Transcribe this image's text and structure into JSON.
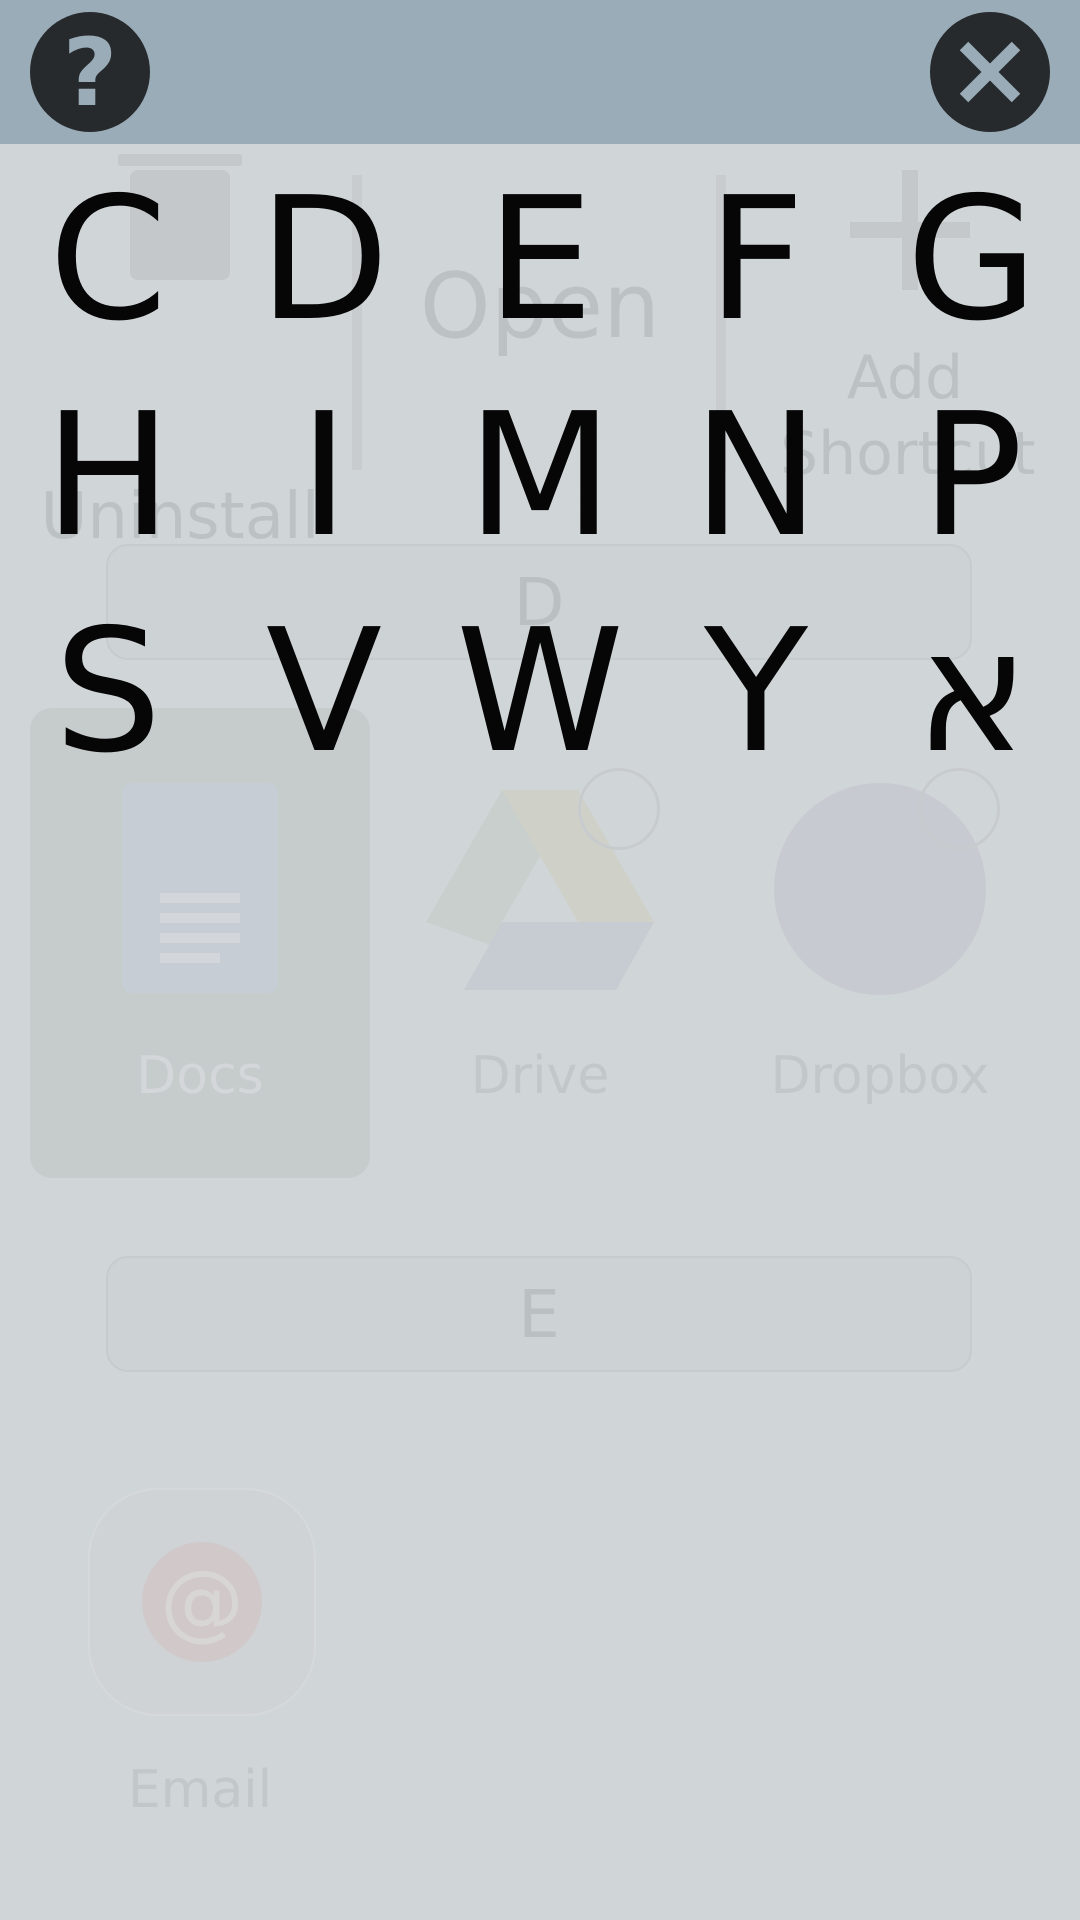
{
  "header": {
    "help_icon": "help-icon",
    "help_glyph": "?",
    "close_icon": "close-icon"
  },
  "letters": [
    "C",
    "D",
    "E",
    "F",
    "G",
    "H",
    "I",
    "M",
    "N",
    "P",
    "S",
    "V",
    "W",
    "Y",
    "א"
  ],
  "background": {
    "actions": {
      "uninstall": "Uninstall",
      "open": "Open",
      "add_shortcut": "Add Shortcut"
    },
    "sections": {
      "d": "D",
      "e": "E"
    },
    "apps": {
      "docs": "Docs",
      "drive": "Drive",
      "dropbox": "Dropbox",
      "email": "Email"
    },
    "email_glyph": "@"
  },
  "colors": {
    "topbar": "#9aacb8",
    "button_dark": "#272a2d",
    "overlay": "#d0d5d8",
    "letter": "#060606"
  }
}
